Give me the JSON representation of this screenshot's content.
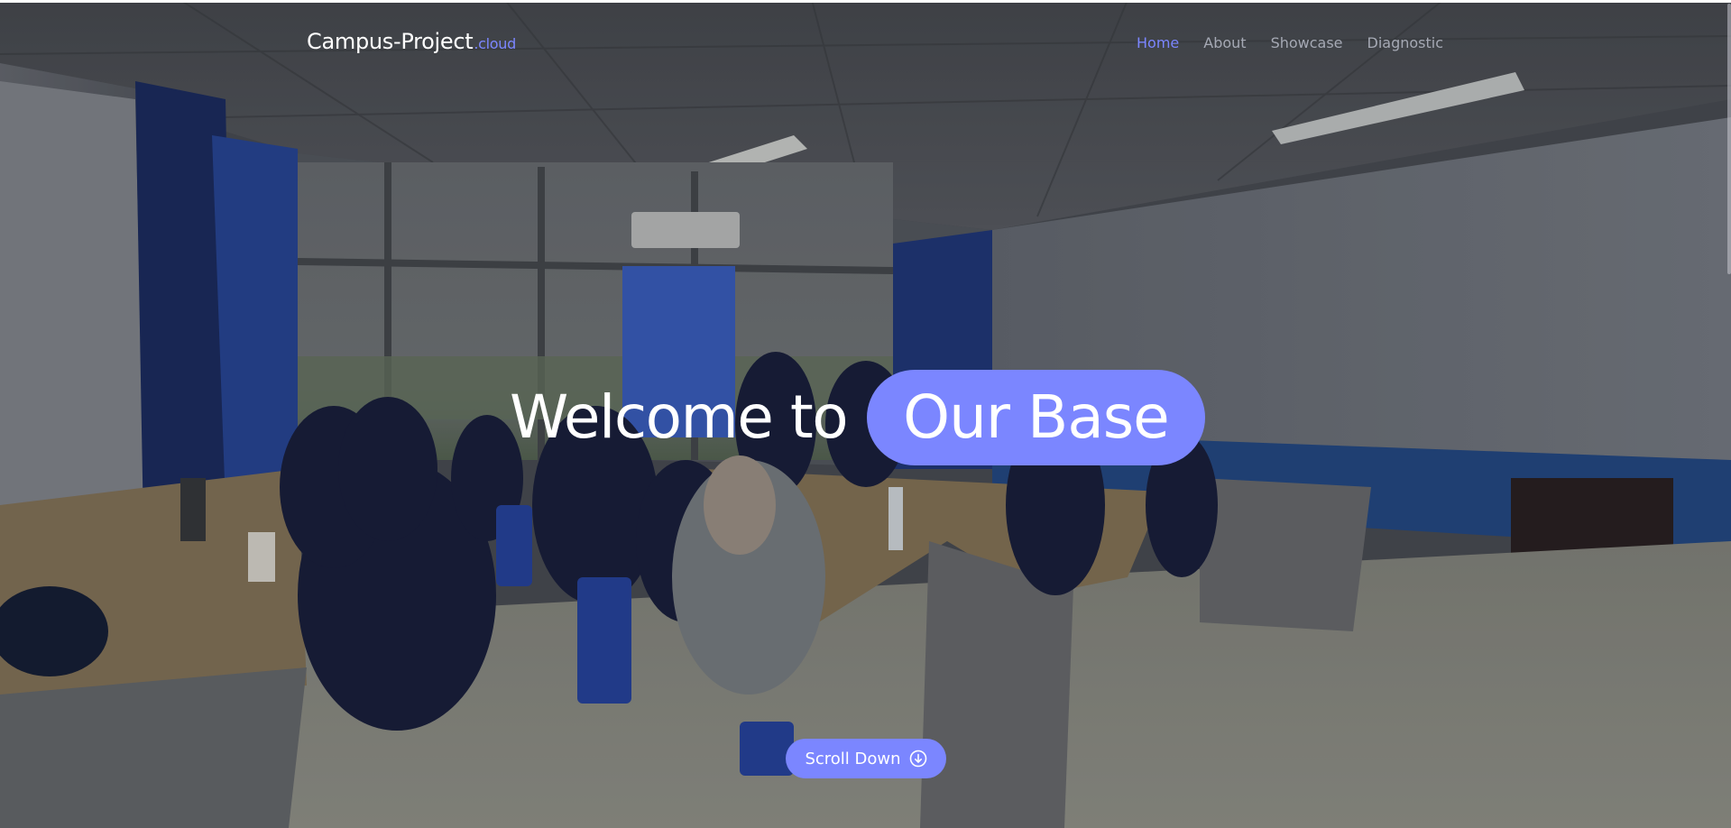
{
  "brand": {
    "name": "Campus-Project",
    "tld": ".cloud"
  },
  "nav": {
    "items": [
      {
        "label": "Home",
        "active": true
      },
      {
        "label": "About",
        "active": false
      },
      {
        "label": "Showcase",
        "active": false
      },
      {
        "label": "Diagnostic",
        "active": false
      }
    ]
  },
  "hero": {
    "headline_prefix": "Welcome to",
    "headline_highlight": "Our Base",
    "background_image": "classroom-group-photo",
    "scroll_button": {
      "label": "Scroll Down",
      "icon": "arrow-down-circle-icon"
    }
  },
  "colors": {
    "accent": "#7b86ff",
    "nav_inactive": "#a5a9b4",
    "text_primary": "#ffffff"
  }
}
